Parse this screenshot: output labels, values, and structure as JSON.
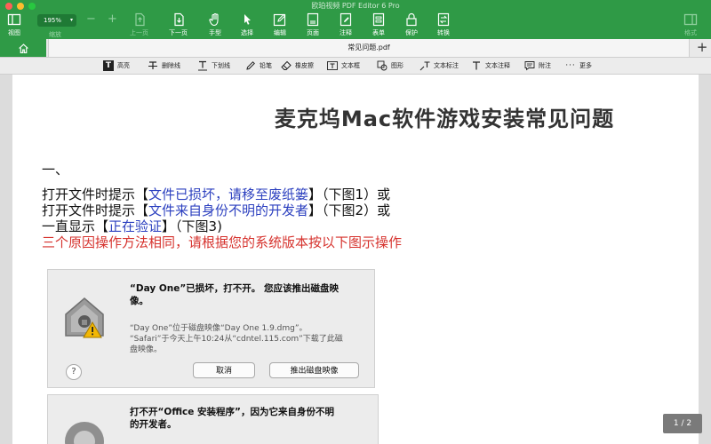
{
  "app": {
    "title": "欧珀视频 PDF Editor 6 Pro"
  },
  "toolbar": {
    "zoom_value": "195%",
    "zoom_label": "缩放",
    "zoom_out": "−",
    "zoom_in": "+",
    "view": "视图",
    "prev_page": "上一页",
    "next_page": "下一页",
    "hand": "手型",
    "select": "选择",
    "edit": "编辑",
    "page": "页面",
    "annotate": "注释",
    "form": "表单",
    "protect": "保护",
    "convert": "转换",
    "format": "格式"
  },
  "tabs": {
    "doc_name": "常见问题.pdf",
    "add": "+"
  },
  "annotation_tools": {
    "highlight": "高亮",
    "strikethrough": "删除线",
    "underline": "下划线",
    "pencil": "铅笔",
    "eraser": "橡皮擦",
    "textbox": "文本框",
    "shape": "图形",
    "text_callout": "文本标注",
    "text_note": "文本注释",
    "note": "附注",
    "more": "更多"
  },
  "document": {
    "title": "麦克坞Mac软件游戏安装常见问题",
    "section": "一、",
    "line1": {
      "a": "打开文件时提示【",
      "b": "文件已损坏，请移至废纸篓",
      "c": "】（下图1）或"
    },
    "line2": {
      "a": "打开文件时提示【",
      "b": "文件来自身份不明的开发者",
      "c": "】（下图2）或"
    },
    "line3": {
      "a": "一直显示【",
      "b": "正在验证",
      "c": "】（下图3)"
    },
    "line4": {
      "a": "三个原因操作方法相同，",
      "b": "请根据您的系统版本按以下图示操作"
    },
    "dialog1": {
      "title_l1": "“Day One”已损坏，打不开。 您应该推出磁盘映",
      "title_l2": "像。",
      "body_l1": "“Day One”位于磁盘映像“Day One 1.9.dmg”。",
      "body_l2": "“Safari”于今天上午10:24从“cdntel.115.com”下载了此磁",
      "body_l3": "盘映像。",
      "help": "?",
      "cancel": "取消",
      "eject": "推出磁盘映像"
    },
    "dialog2": {
      "title_l1": "打不开“Office 安装程序”，因为它来自身份不明",
      "title_l2": "的开发者。"
    }
  },
  "page_indicator": "1 / 2",
  "colors": {
    "brand_green": "#2f9a46",
    "link_blue": "#2b3fbf",
    "alert_red": "#d6322d"
  }
}
